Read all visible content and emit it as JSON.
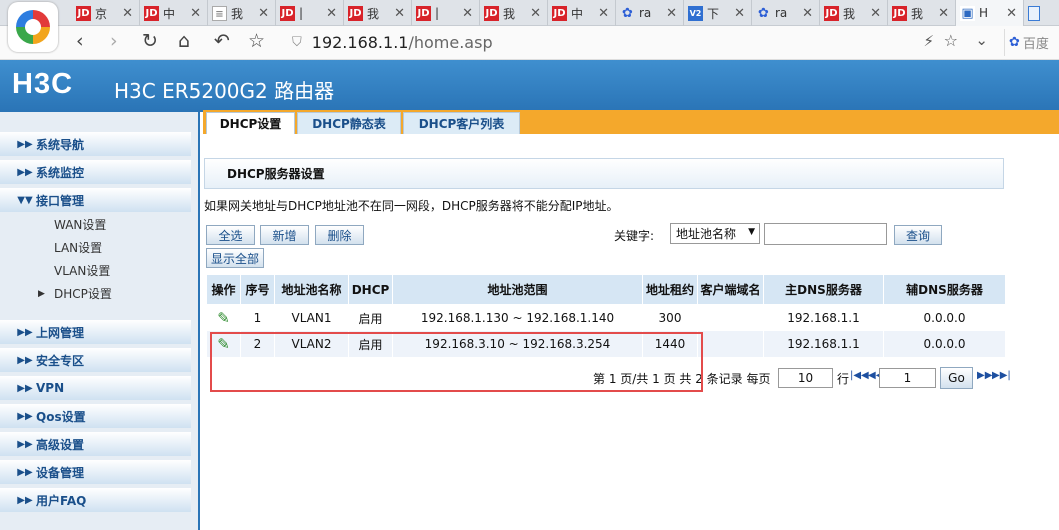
{
  "browser": {
    "tabs": [
      {
        "icon": "jd-icon",
        "text": "京"
      },
      {
        "icon": "jd-icon",
        "text": "中"
      },
      {
        "icon": "doc-icon",
        "text": "我"
      },
      {
        "icon": "jd-icon",
        "text": "|"
      },
      {
        "icon": "jd-icon",
        "text": "我"
      },
      {
        "icon": "jd-icon",
        "text": "|"
      },
      {
        "icon": "jd-icon",
        "text": "我"
      },
      {
        "icon": "jd-icon",
        "text": "中"
      },
      {
        "icon": "baidu-icon",
        "text": "ra"
      },
      {
        "icon": "v2-icon",
        "text": "下"
      },
      {
        "icon": "baidu-icon",
        "text": "ra"
      },
      {
        "icon": "jd-icon",
        "text": "我"
      },
      {
        "icon": "jd-icon",
        "text": "我"
      },
      {
        "icon": "h3c-icon",
        "text": "H"
      }
    ],
    "url_host": "192.168.1.1",
    "url_path": "/home.asp",
    "search_text": "百度"
  },
  "header": {
    "brand": "H3C",
    "title": "H3C ER5200G2 路由器"
  },
  "sidebar": {
    "menus": [
      {
        "label": "系统导航"
      },
      {
        "label": "系统监控"
      },
      {
        "label": "接口管理"
      },
      {
        "label": "上网管理"
      },
      {
        "label": "安全专区"
      },
      {
        "label": "VPN"
      },
      {
        "label": "Qos设置"
      },
      {
        "label": "高级设置"
      },
      {
        "label": "设备管理"
      },
      {
        "label": "用户FAQ"
      }
    ],
    "subitems": [
      {
        "label": "WAN设置"
      },
      {
        "label": "LAN设置"
      },
      {
        "label": "VLAN设置"
      },
      {
        "label": "DHCP设置"
      }
    ]
  },
  "page_tabs": [
    {
      "label": "DHCP设置"
    },
    {
      "label": "DHCP静态表"
    },
    {
      "label": "DHCP客户列表"
    }
  ],
  "section_title": "DHCP服务器设置",
  "notice": "如果网关地址与DHCP地址池不在同一网段，DHCP服务器将不能分配IP地址。",
  "buttons": {
    "select_all": "全选",
    "add": "新增",
    "delete": "删除",
    "show_all": "显示全部",
    "query": "查询",
    "go": "Go"
  },
  "search": {
    "label": "关键字:",
    "field_value": "地址池名称",
    "keyword": ""
  },
  "table": {
    "headers": [
      "操作",
      "序号",
      "地址池名称",
      "DHCP",
      "地址池范围",
      "地址租约",
      "客户端域名",
      "主DNS服务器",
      "辅DNS服务器"
    ],
    "rows": [
      {
        "index": "1",
        "pool_name": "VLAN1",
        "dhcp": "启用",
        "range": "192.168.1.130 ~ 192.168.1.140",
        "lease": "300",
        "domain": "",
        "dns1": "192.168.1.1",
        "dns2": "0.0.0.0"
      },
      {
        "index": "2",
        "pool_name": "VLAN2",
        "dhcp": "启用",
        "range": "192.168.3.10 ~ 192.168.3.254",
        "lease": "1440",
        "domain": "",
        "dns1": "192.168.1.1",
        "dns2": "0.0.0.0"
      }
    ]
  },
  "pager": {
    "summary": "第 1 页/共 1 页 共 2 条记录 每页",
    "per_page": "10",
    "rows_label": "行",
    "page": "1"
  }
}
